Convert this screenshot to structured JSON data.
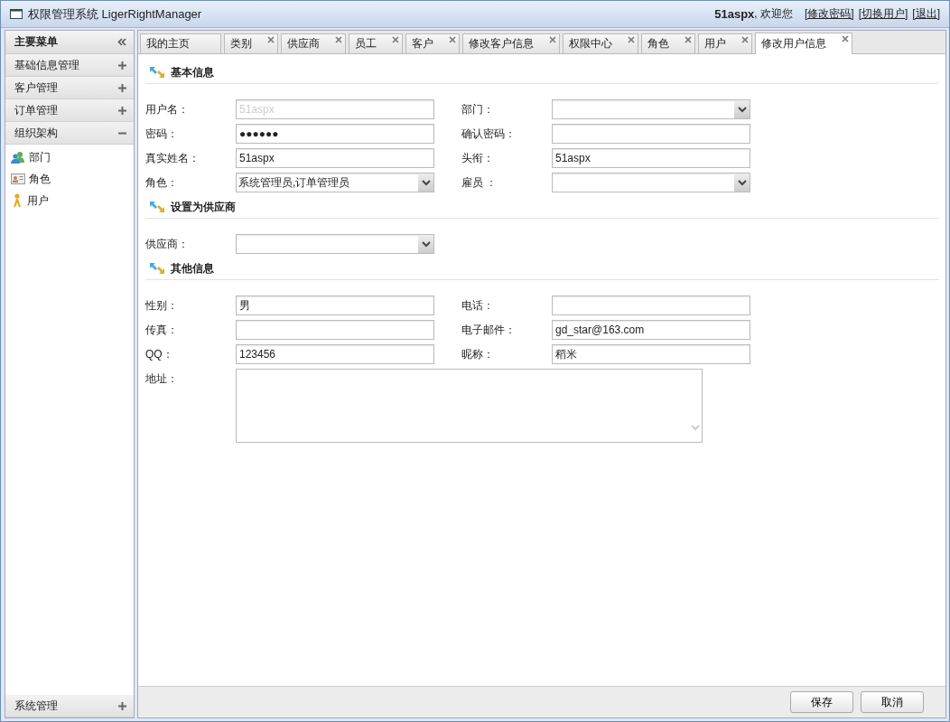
{
  "window": {
    "title": "权限管理系统 LigerRightManager"
  },
  "header": {
    "user": "51aspx",
    "greeting": ", 欢迎您",
    "links": [
      "[修改密码]",
      "[切换用户]",
      "[退出]"
    ]
  },
  "sidebar": {
    "title": "主要菜单",
    "sections": [
      {
        "label": "基础信息管理",
        "expanded": false
      },
      {
        "label": "客户管理",
        "expanded": false
      },
      {
        "label": "订单管理",
        "expanded": false
      },
      {
        "label": "组织架构",
        "expanded": true,
        "items": [
          {
            "label": "部门",
            "kind": "department"
          },
          {
            "label": "角色",
            "kind": "role"
          },
          {
            "label": "用户",
            "kind": "user"
          }
        ]
      }
    ],
    "bottom_section": {
      "label": "系统管理",
      "expanded": false
    }
  },
  "tabs": [
    {
      "label": "我的主页",
      "closable": false,
      "selected": false
    },
    {
      "label": "类别",
      "closable": true,
      "selected": false
    },
    {
      "label": "供应商",
      "closable": true,
      "selected": false
    },
    {
      "label": "员工",
      "closable": true,
      "selected": false
    },
    {
      "label": "客户",
      "closable": true,
      "selected": false
    },
    {
      "label": "修改客户信息",
      "closable": true,
      "selected": false
    },
    {
      "label": "权限中心",
      "closable": true,
      "selected": false
    },
    {
      "label": "角色",
      "closable": true,
      "selected": false
    },
    {
      "label": "用户",
      "closable": true,
      "selected": false
    },
    {
      "label": "修改用户信息",
      "closable": true,
      "selected": true
    }
  ],
  "form_sections": [
    {
      "title": "基本信息",
      "fields": [
        {
          "label": "用户名：",
          "kind": "text",
          "value": "51aspx",
          "disabled": true
        },
        {
          "label": "部门：",
          "kind": "select"
        },
        {
          "label": "密码：",
          "kind": "text",
          "value": "●●●●●●",
          "disabled": false
        },
        {
          "label": "确认密码：",
          "kind": "text"
        },
        {
          "label": "真实姓名：",
          "kind": "text",
          "value": "51aspx",
          "disabled": false
        },
        {
          "label": "头衔：",
          "kind": "text",
          "value": "51aspx",
          "disabled": false
        },
        {
          "label": "角色：",
          "kind": "select",
          "value": "系统管理员,订单管理员"
        },
        {
          "label": "雇员 ：",
          "kind": "select"
        }
      ]
    },
    {
      "title": "设置为供应商",
      "fields": [
        {
          "label": "供应商：",
          "kind": "select"
        }
      ]
    },
    {
      "title": "其他信息",
      "fields": [
        {
          "label": "性别：",
          "kind": "text",
          "value": "男",
          "disabled": false
        },
        {
          "label": "电话：",
          "kind": "text"
        },
        {
          "label": "传真：",
          "kind": "text"
        },
        {
          "label": "电子邮件：",
          "kind": "text",
          "value": "gd_star@163.com",
          "disabled": false
        },
        {
          "label": "QQ：",
          "kind": "text",
          "value": "123456",
          "disabled": false
        },
        {
          "label": "昵称：",
          "kind": "text",
          "value": "稻米",
          "disabled": false
        },
        {
          "label": "地址：",
          "kind": "textarea"
        }
      ]
    }
  ],
  "buttons": [
    "保存",
    "取消"
  ]
}
